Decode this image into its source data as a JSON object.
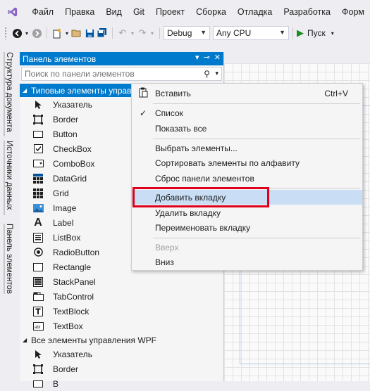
{
  "menubar": {
    "items": [
      "Файл",
      "Правка",
      "Вид",
      "Git",
      "Проект",
      "Сборка",
      "Отладка",
      "Разработка",
      "Форм"
    ]
  },
  "toolbar": {
    "config": "Debug",
    "platform": "Any CPU",
    "run_label": "Пуск"
  },
  "side_tabs": [
    "Структура документа",
    "Источники данных",
    "Панель элементов"
  ],
  "toolbox": {
    "title": "Панель элементов",
    "search_placeholder": "Поиск по панели элементов",
    "group1": "Типовые элементы управ",
    "tools": [
      "Указатель",
      "Border",
      "Button",
      "CheckBox",
      "ComboBox",
      "DataGrid",
      "Grid",
      "Image",
      "Label",
      "ListBox",
      "RadioButton",
      "Rectangle",
      "StackPanel",
      "TabControl",
      "TextBlock",
      "TextBox"
    ],
    "group2": "Все элементы управления WPF",
    "tools2": [
      "Указатель",
      "Border",
      "B"
    ]
  },
  "context_menu": {
    "paste": "Вставить",
    "paste_shortcut": "Ctrl+V",
    "list": "Список",
    "show_all": "Показать все",
    "choose_items": "Выбрать элементы...",
    "sort": "Сортировать элементы по алфавиту",
    "reset": "Сброс панели элементов",
    "add_tab": "Добавить вкладку",
    "delete_tab": "Удалить вкладку",
    "rename_tab": "Переименовать вкладку",
    "move_up": "Вверх",
    "move_down": "Вниз"
  },
  "colors": {
    "accent": "#007acc",
    "highlight_box": "#e0001b",
    "vs_purple": "#865fc5"
  }
}
